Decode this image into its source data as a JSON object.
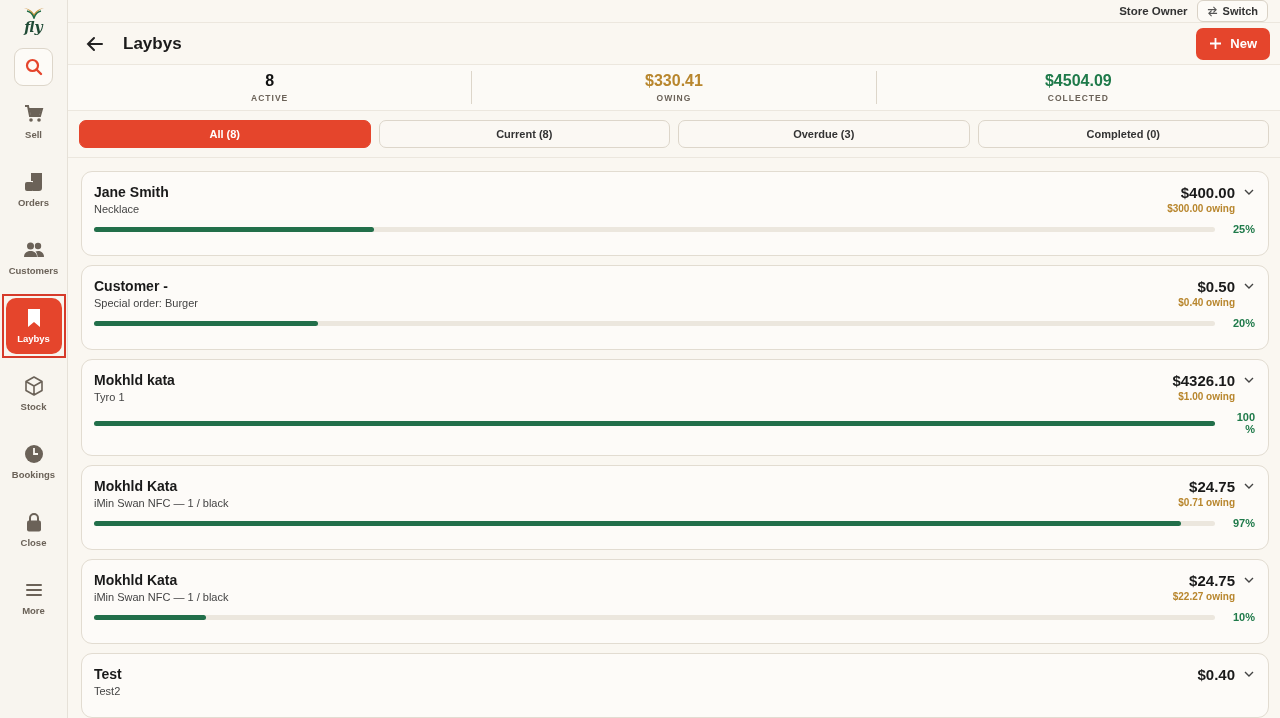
{
  "brand": {
    "name": "fly"
  },
  "sidebar": {
    "items": [
      {
        "label": "Sell",
        "selected": false,
        "highlighted": false
      },
      {
        "label": "Orders",
        "selected": false,
        "highlighted": false
      },
      {
        "label": "Customers",
        "selected": false,
        "highlighted": false
      },
      {
        "label": "Laybys",
        "selected": true,
        "highlighted": true
      },
      {
        "label": "Stock",
        "selected": false,
        "highlighted": false
      },
      {
        "label": "Bookings",
        "selected": false,
        "highlighted": false
      },
      {
        "label": "Close",
        "selected": false,
        "highlighted": false
      },
      {
        "label": "More",
        "selected": false,
        "highlighted": false
      }
    ]
  },
  "top_bar": {
    "user": "Store Owner",
    "switch_button": "Switch"
  },
  "header": {
    "title": "Laybys",
    "new_button": "New"
  },
  "stats": [
    {
      "value": "8",
      "label": "ACTIVE"
    },
    {
      "value": "$330.41",
      "label": "OWING"
    },
    {
      "value": "$4504.09",
      "label": "COLLECTED"
    }
  ],
  "tabs": [
    {
      "label": "All (8)",
      "selected": true
    },
    {
      "label": "Current (8)",
      "selected": false
    },
    {
      "label": "Overdue (3)",
      "selected": false
    },
    {
      "label": "Completed (0)",
      "selected": false
    }
  ],
  "laybys": [
    {
      "name": "Jane Smith",
      "item": "Necklace",
      "total": "$400.00",
      "owing": "$300.00 owing",
      "level": 0.25,
      "percent": "25%"
    },
    {
      "name": "Customer -",
      "item": "Special order: Burger",
      "total": "$0.50",
      "owing": "$0.40 owing",
      "level": 0.2,
      "percent": "20%"
    },
    {
      "name": "Mokhld kata",
      "item": "Tyro 1",
      "total": "$4326.10",
      "owing": "$1.00 owing",
      "level": 1,
      "percent": "100 %"
    },
    {
      "name": "Mokhld Kata",
      "item": "iMin Swan NFC — 1 / black",
      "total": "$24.75",
      "owing": "$0.71 owing",
      "level": 0.97,
      "percent": "97%"
    },
    {
      "name": "Mokhld Kata",
      "item": "iMin Swan NFC — 1 / black",
      "total": "$24.75",
      "owing": "$22.27 owing",
      "level": 0.1,
      "percent": "10%"
    },
    {
      "name": "Test",
      "item": "Test2",
      "total": "$0.40"
    }
  ]
}
